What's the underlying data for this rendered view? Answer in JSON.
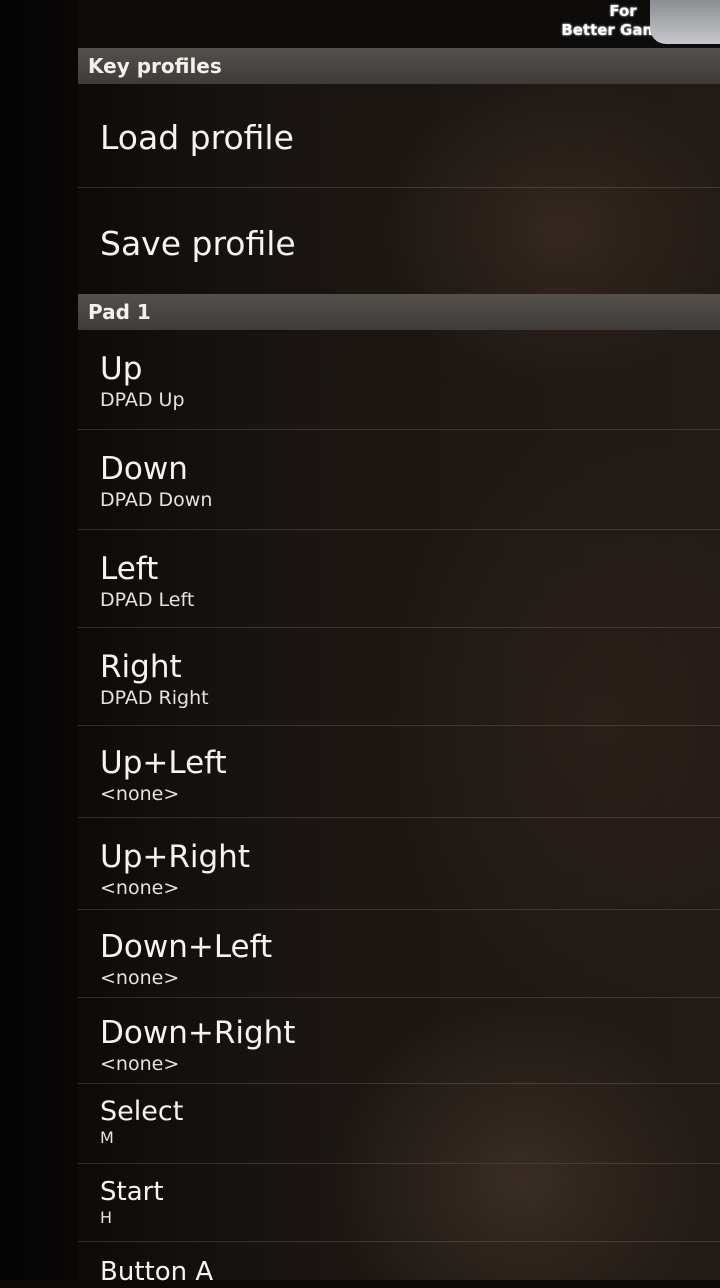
{
  "topbar": {
    "logo_text": "For\nBetter Gaming"
  },
  "sections": [
    {
      "header": "Key profiles",
      "items": [
        {
          "title": "Load profile"
        },
        {
          "title": "Save profile"
        }
      ]
    },
    {
      "header": "Pad 1",
      "items": [
        {
          "title": "Up",
          "summary": "DPAD Up"
        },
        {
          "title": "Down",
          "summary": "DPAD Down"
        },
        {
          "title": "Left",
          "summary": "DPAD Left"
        },
        {
          "title": "Right",
          "summary": "DPAD Right"
        },
        {
          "title": "Up+Left",
          "summary": "<none>"
        },
        {
          "title": "Up+Right",
          "summary": "<none>"
        },
        {
          "title": "Down+Left",
          "summary": "<none>"
        },
        {
          "title": "Down+Right",
          "summary": "<none>"
        },
        {
          "title": "Select",
          "summary": "M"
        },
        {
          "title": "Start",
          "summary": "H"
        },
        {
          "title": "Button A"
        }
      ]
    }
  ]
}
